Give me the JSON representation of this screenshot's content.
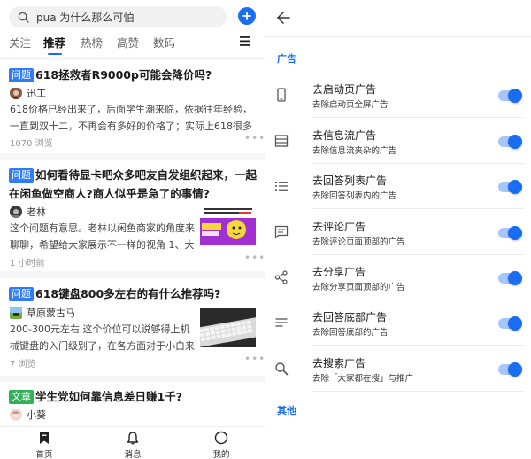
{
  "feed": {
    "search_placeholder": "pua 为什么那么可怕",
    "tabs": [
      "关注",
      "推荐",
      "热榜",
      "高赞",
      "数码"
    ],
    "active_tab": 1,
    "cards": [
      {
        "badge": "问题",
        "title": "618拯救者R9000p可能会降价吗?",
        "author": "迅工",
        "excerpt": "618价格已经出来了，后面学生潮来临，依据往年经验，一直到双十二，不再会有多好的价格了；实际上618很多学生还没确...",
        "meta": "1070 浏览"
      },
      {
        "badge": "问题",
        "title": "如何看待显卡吧众多吧友自发组织起来，一起在闲鱼做空商人?商人似乎是急了的事情?",
        "author": "老林",
        "excerpt": "这个问题有意思。老林以闲鱼商家的角度来聊聊，希望给大家展示不一样的视角 1、大家组...",
        "meta": "1 小时前"
      },
      {
        "badge": "问题",
        "title": "618键盘800多左右的有什么推荐吗?",
        "author": "草原蒙古马",
        "excerpt": "200-300元左右 这个价位可以说够得上机械键盘的入门级别了，在各方面对于小白来说都能得...",
        "meta": "7 浏览"
      },
      {
        "badge": "文章",
        "title": "学生党如何靠信息差日赚1千?",
        "author": "小葵",
        "excerpt": "",
        "meta": ""
      }
    ],
    "thumb_texts": {
      "card2_top": "老人用两的安定老板 当别人的口乐",
      "card2_mid": "好用 好用",
      "card2_badge": "宣传牌伸出"
    },
    "nav": [
      {
        "label": "首页",
        "icon": "home-icon"
      },
      {
        "label": "消息",
        "icon": "bell-icon"
      },
      {
        "label": "我的",
        "icon": "profile-icon"
      }
    ]
  },
  "settings": {
    "section_ads": "广告",
    "section_other": "其他",
    "items": [
      {
        "title": "去启动页广告",
        "desc": "去除启动页全屏广告",
        "icon": "phone-icon",
        "enabled": true
      },
      {
        "title": "去信息流广告",
        "desc": "去除信息流夹杂的广告",
        "icon": "feed-icon",
        "enabled": true
      },
      {
        "title": "去回答列表广告",
        "desc": "去除回答列表内的广告",
        "icon": "list-icon",
        "enabled": true
      },
      {
        "title": "去评论广告",
        "desc": "去除评论页面顶部的广告",
        "icon": "comment-icon",
        "enabled": true
      },
      {
        "title": "去分享广告",
        "desc": "去除分享页面顶部的广告",
        "icon": "share-icon",
        "enabled": true
      },
      {
        "title": "去回答底部广告",
        "desc": "去除回答底部的广告",
        "icon": "text-lines-icon",
        "enabled": true
      },
      {
        "title": "去搜索广告",
        "desc": "去除「大家都在搜」与推广",
        "icon": "search-icon",
        "enabled": true
      }
    ]
  },
  "colors": {
    "accent": "#1a6cf0",
    "badge_blue": "#2f7cf6",
    "badge_green": "#32b15a",
    "toggle_track": "#a6c6fa"
  }
}
